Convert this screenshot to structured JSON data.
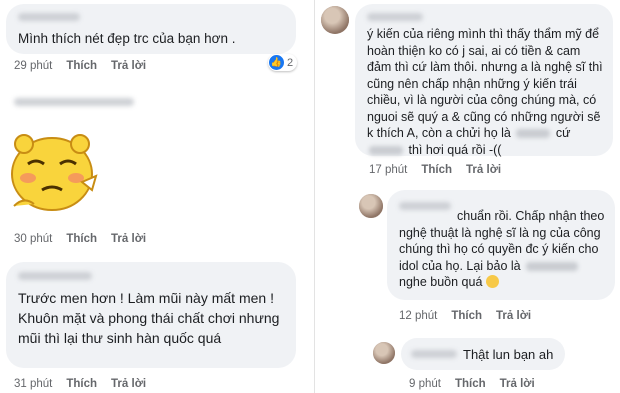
{
  "left": {
    "c1": {
      "text": "Mình thích nét đẹp trc của bạn hơn .",
      "time": "29 phút",
      "like": "Thích",
      "reply": "Trả lời",
      "reactions": "2"
    },
    "c2": {
      "sticker": "sticker-bear-face",
      "time": "30 phút",
      "like": "Thích",
      "reply": "Trả lời"
    },
    "c3": {
      "text": "Trước men hơn ! Làm mũi này mất men ! Khuôn mặt và phong thái chất chơi nhưng mũi thì lại thư sinh hàn quốc quá",
      "time": "31 phút",
      "like": "Thích",
      "reply": "Trả lời"
    }
  },
  "right": {
    "c1": {
      "text_before": "ý kiến của riêng mình thì thấy thẩm mỹ để hoàn thiện ko có j sai, ai có tiền & cam đảm thì cứ làm thôi. nhưng a là nghệ sĩ thì cũng nên chấp nhận những ý kiến trái chiều, vì là người của công chúng mà, có nguoi sẽ quý a & cũng có những người sẽ k thích A, còn a chửi họ là",
      "text_mid": "cứ",
      "text_after": "thì hơi quá rồi -((",
      "time": "17 phút",
      "like": "Thích",
      "reply": "Trả lời"
    },
    "c2": {
      "text_start": "chuẩn rồi. Chấp nhận theo nghệ thuật là nghệ sĩ là ng của công chúng thì họ có quyền đc ý kiến cho idol của họ. Lại bảo là",
      "text_end": "nghe buồn quá",
      "emoji": "sad-face-emoji",
      "time": "12 phút",
      "like": "Thích",
      "reply": "Trả lời"
    },
    "c3": {
      "text": "Thật lun bạn ah",
      "time": "9 phút",
      "like": "Thích",
      "reply": "Trả lời"
    }
  },
  "colors": {
    "bubble": "#f0f2f5",
    "meta": "#65676b",
    "like_badge": "#1877f2"
  }
}
